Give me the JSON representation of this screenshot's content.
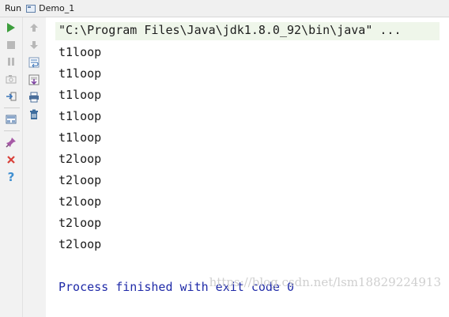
{
  "titlebar": {
    "run_label": "Run",
    "tab_label": "Demo_1"
  },
  "toolbar": {
    "left": [
      "run-icon",
      "stop-icon",
      "pause-icon",
      "screenshot-icon",
      "login-icon",
      "layout-icon",
      "pin-icon",
      "close-icon",
      "help-icon"
    ],
    "right": [
      "up-arrow-icon",
      "down-arrow-icon",
      "soft-wrap-icon",
      "scroll-to-end-icon",
      "print-icon",
      "trash-icon"
    ]
  },
  "console": {
    "command": "\"C:\\Program Files\\Java\\jdk1.8.0_92\\bin\\java\" ...",
    "lines": [
      "t1loop",
      "t1loop",
      "t1loop",
      "t1loop",
      "t1loop",
      "t2loop",
      "t2loop",
      "t2loop",
      "t2loop",
      "t2loop"
    ],
    "exit_message": "Process finished with exit code 0"
  },
  "watermark": "https://blog.csdn.net/lsm18829224913"
}
